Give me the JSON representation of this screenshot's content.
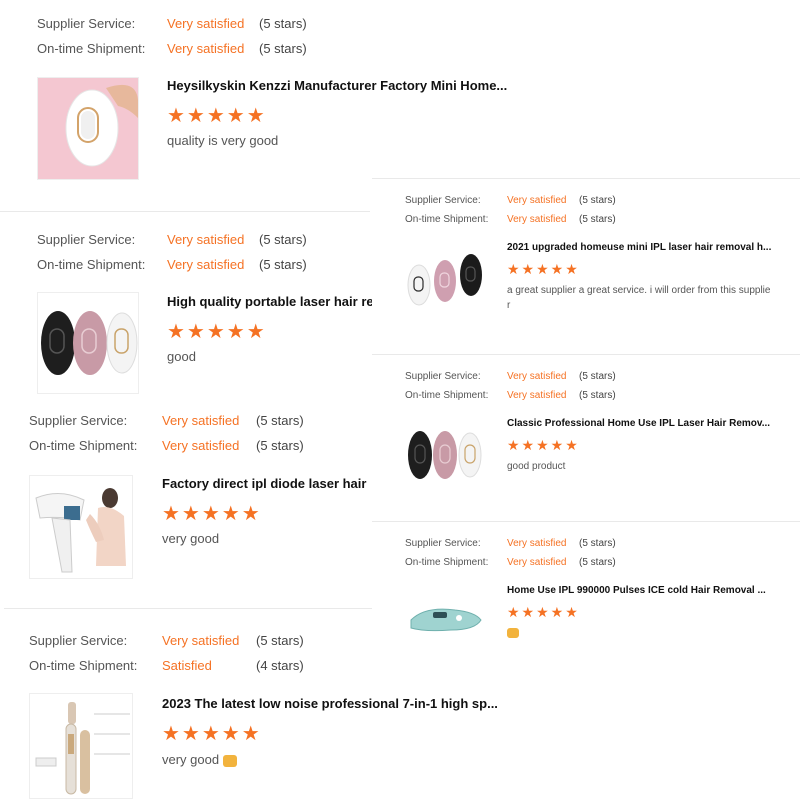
{
  "labels": {
    "supplier_service": "Supplier Service:",
    "ontime_shipment": "On-time Shipment:"
  },
  "stars_glyph": "★★★★★",
  "colors": {
    "accent": "#f57224",
    "label": "#555555"
  },
  "reviews": [
    {
      "supplier_rating": "Very satisfied",
      "supplier_stars": "(5 stars)",
      "shipment_rating": "Very satisfied",
      "shipment_stars": "(5 stars)",
      "title": "Heysilkyskin Kenzzi Manufacturer Factory Mini Home...",
      "rating": 5,
      "comment": "quality is very good",
      "image": "pink-ipl-device-photo"
    },
    {
      "supplier_rating": "Very satisfied",
      "supplier_stars": "(5 stars)",
      "shipment_rating": "Very satisfied",
      "shipment_stars": "(5 stars)",
      "title": "High quality portable laser hair re",
      "rating": 5,
      "comment": "good",
      "image": "three-ipl-devices-photo"
    },
    {
      "supplier_rating": "Very satisfied",
      "supplier_stars": "(5 stars)",
      "shipment_rating": "Very satisfied",
      "shipment_stars": "(5 stars)",
      "title": "Factory direct ipl diode laser hair",
      "rating": 5,
      "comment": "very good",
      "image": "ipl-device-model-photo"
    },
    {
      "supplier_rating": "Very satisfied",
      "supplier_stars": "(5 stars)",
      "shipment_rating": "Satisfied",
      "shipment_stars": "(4 stars)",
      "title": "2023 The latest low noise professional 7-in-1 high sp...",
      "rating": 5,
      "comment": "very good",
      "image": "hair-styler-set-photo"
    },
    {
      "supplier_rating": "Very satisfied",
      "supplier_stars": "(5 stars)",
      "shipment_rating": "Very satisfied",
      "shipment_stars": "(5 stars)",
      "title": "2021 upgraded homeuse mini IPL laser hair removal h...",
      "rating": 5,
      "comment": "a great supplier a great service. i will order from this supplie",
      "comment2": "r",
      "image": "three-ipl-devices-photo"
    },
    {
      "supplier_rating": "Very satisfied",
      "supplier_stars": "(5 stars)",
      "shipment_rating": "Very satisfied",
      "shipment_stars": "(5 stars)",
      "title": "Classic Professional Home Use IPL Laser Hair Remov...",
      "rating": 5,
      "comment": "good product",
      "image": "three-ipl-devices-photo"
    },
    {
      "supplier_rating": "Very satisfied",
      "supplier_stars": "(5 stars)",
      "shipment_rating": "Very satisfied",
      "shipment_stars": "(5 stars)",
      "title": "Home Use IPL 990000 Pulses ICE cold Hair Removal ...",
      "rating": 5,
      "comment": "",
      "image": "ice-cold-ipl-device-photo"
    }
  ]
}
